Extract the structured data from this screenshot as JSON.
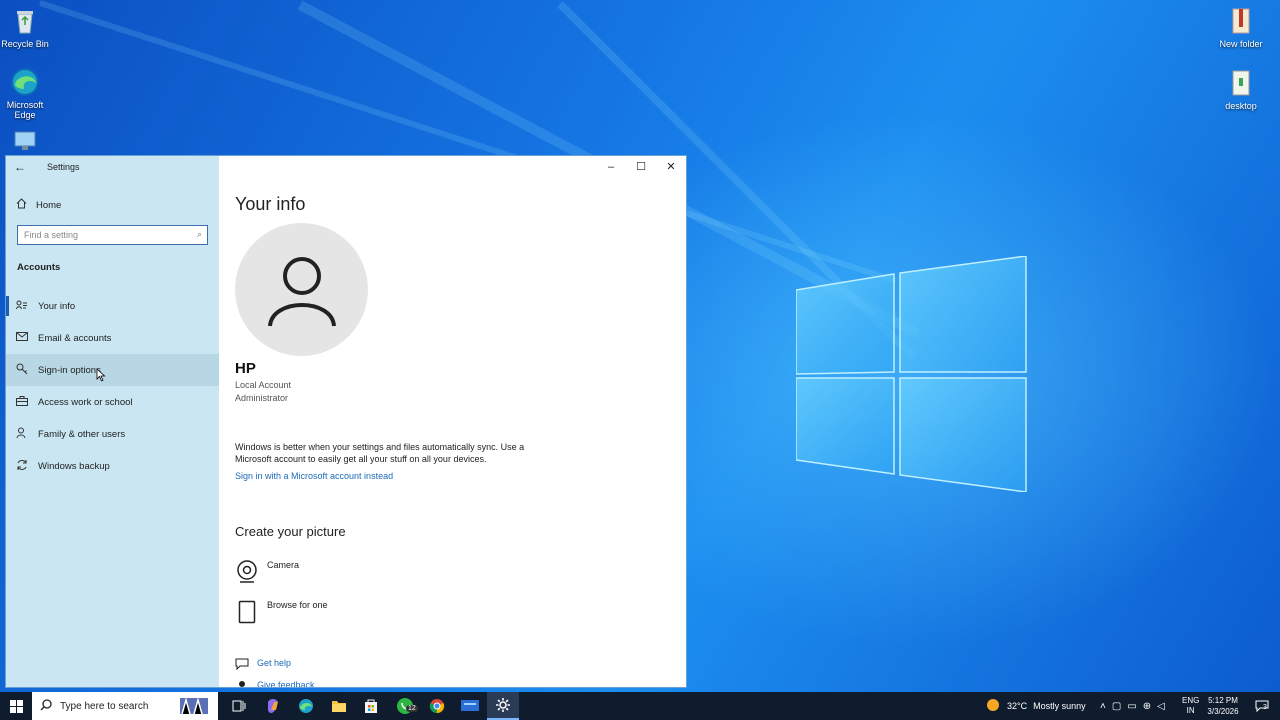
{
  "desktop": {
    "icons_left": [
      {
        "label_line1": "Recycle Bin",
        "label_line2": ""
      },
      {
        "label_line1": "Microsoft",
        "label_line2": "Edge"
      }
    ],
    "icons_right": [
      {
        "label": "New folder"
      },
      {
        "label": "desktop"
      }
    ]
  },
  "window": {
    "title": "Settings",
    "minimize": "–",
    "maximize": "☐",
    "close": "✕",
    "back": "←"
  },
  "sidebar": {
    "home_label": "Home",
    "search_placeholder": "Find a setting",
    "section": "Accounts",
    "items": [
      {
        "label": "Your info",
        "icon": "person-card-icon"
      },
      {
        "label": "Email & accounts",
        "icon": "mail-icon"
      },
      {
        "label": "Sign-in options",
        "icon": "key-icon"
      },
      {
        "label": "Access work or school",
        "icon": "briefcase-icon"
      },
      {
        "label": "Family & other users",
        "icon": "person-add-icon"
      },
      {
        "label": "Windows backup",
        "icon": "sync-icon"
      }
    ]
  },
  "content": {
    "heading": "Your info",
    "user_name": "HP",
    "account_type": "Local Account",
    "role": "Administrator",
    "sync_text": "Windows is better when your settings and files automatically sync. Use a Microsoft account to easily get all your stuff on all your devices.",
    "signin_link": "Sign in with a Microsoft account instead",
    "picture_heading": "Create your picture",
    "camera_label": "Camera",
    "browse_label": "Browse for one",
    "help_link": "Get help",
    "feedback_link": "Give feedback"
  },
  "taskbar": {
    "search_placeholder": "Type here to search",
    "whatsapp_badge": "12",
    "weather_temp": "32°C",
    "weather_desc": "Mostly sunny",
    "lang_line1": "ENG",
    "lang_line2": "IN",
    "time": "5:12 PM",
    "date": "3/3/2026",
    "notification_count": "3"
  }
}
